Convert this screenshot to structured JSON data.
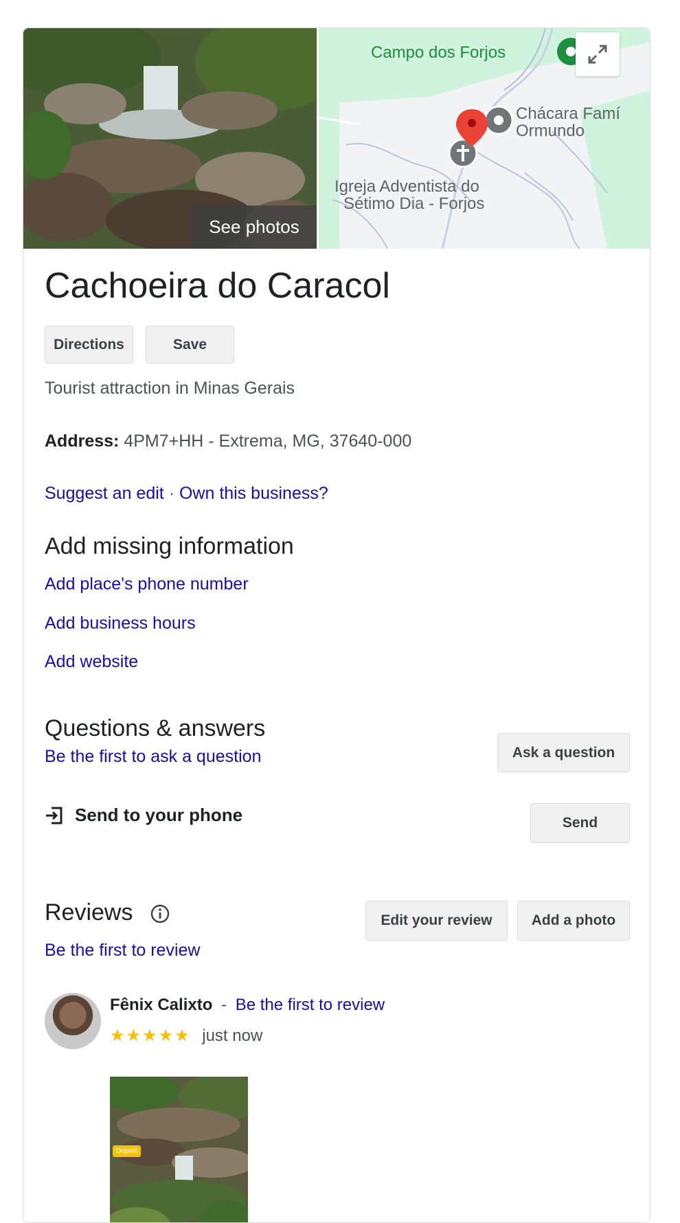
{
  "media": {
    "see_photos": "See photos",
    "map_labels": {
      "campo": "Campo dos Forjos",
      "chacara_line1": "Chácara Famí",
      "chacara_line2": "Ormundo",
      "igreja_line1": "Igreja Adventista do",
      "igreja_line2": "Sétimo Dia - Forjos"
    },
    "expand_icon": "expand-icon"
  },
  "place": {
    "title": "Cachoeira do Caracol",
    "category": "Tourist attraction in Minas Gerais",
    "address_label": "Address:",
    "address_value": "4PM7+HH - Extrema, MG, 37640-000"
  },
  "actions": {
    "directions": "Directions",
    "save": "Save"
  },
  "edit_links": {
    "suggest": "Suggest an edit",
    "separator": "·",
    "own": "Own this business?"
  },
  "missing_info": {
    "heading": "Add missing information",
    "items": [
      "Add place's phone number",
      "Add business hours",
      "Add website"
    ]
  },
  "qa": {
    "heading": "Questions & answers",
    "first": "Be the first to ask a question",
    "ask_button": "Ask a question"
  },
  "send_phone": {
    "label": "Send to your phone",
    "button": "Send"
  },
  "reviews": {
    "heading": "Reviews",
    "first": "Be the first to review",
    "edit_button": "Edit your review",
    "add_photo_button": "Add a photo",
    "review": {
      "author": "Fênix Calixto",
      "dash": "-",
      "link": "Be the first to review",
      "rating": 5,
      "stars": "★★★★★",
      "time": "just now",
      "photo_tag": "Depois"
    }
  },
  "colors": {
    "link": "#1a0dab",
    "star": "#fbbc04",
    "map_green": "#1e8e3e",
    "pin_red": "#ea4335"
  }
}
